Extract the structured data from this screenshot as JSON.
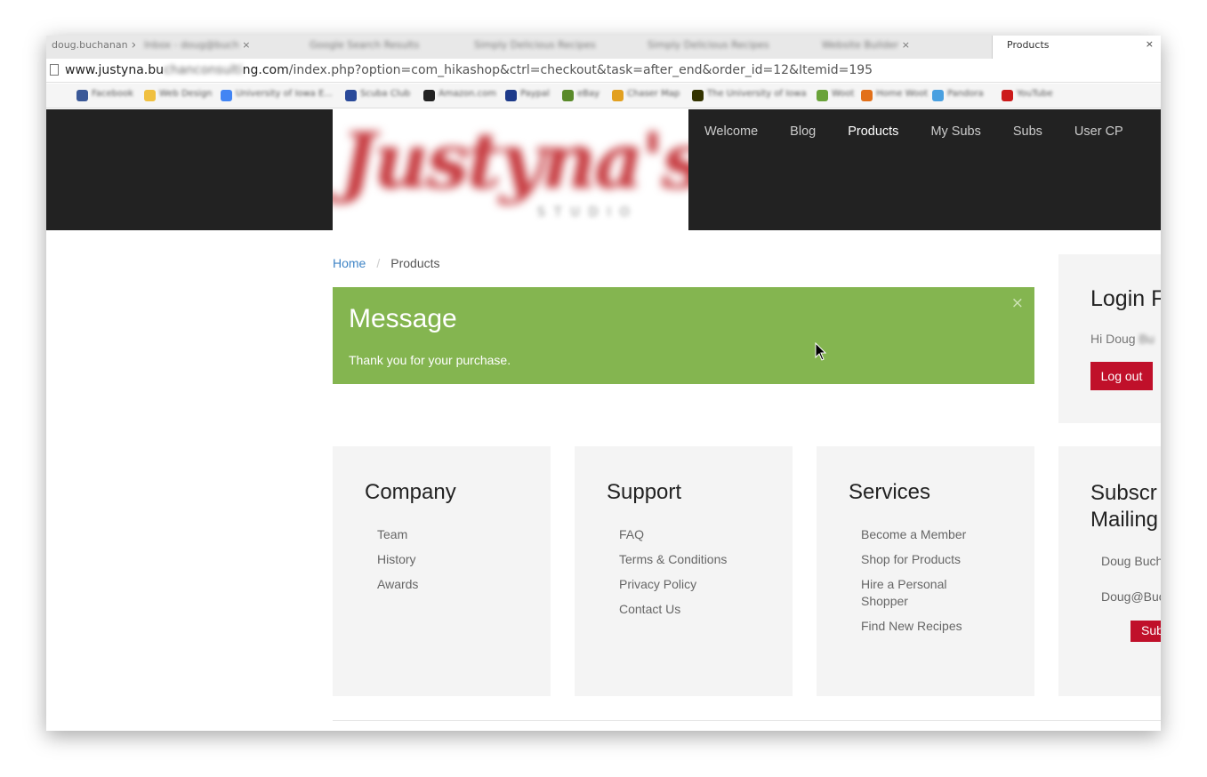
{
  "browser": {
    "tabs": [
      {
        "label": "doug.buchanan",
        "blurred": false
      },
      {
        "label": "Inbox - doug@buch",
        "blurred": true
      },
      {
        "label": "Google Search Results",
        "blurred": true
      },
      {
        "label": "Simply Delicious Recipes",
        "blurred": true
      },
      {
        "label": "Simply Delicious Recipes",
        "blurred": true
      },
      {
        "label": "Website Builder",
        "blurred": true
      }
    ],
    "active_tab": {
      "label": "Products",
      "close": "×"
    },
    "url": {
      "host_visible_start": "www.justyna.bu",
      "host_blurred": "chanconsulti",
      "host_visible_end": "ng.com",
      "path": "/index.php?option=com_hikashop&ctrl=checkout&task=after_end&order_id=12&Itemid=195"
    },
    "bookmarks": [
      {
        "label": "Facebook",
        "color": "#3b5998"
      },
      {
        "label": "Web Design",
        "color": "#f0c040"
      },
      {
        "label": "University of Iowa E...",
        "color": "#4285f4"
      },
      {
        "label": "Scuba Club",
        "color": "#2a4a9a"
      },
      {
        "label": "Amazon.com",
        "color": "#222222"
      },
      {
        "label": "Paypal",
        "color": "#1d3a8a"
      },
      {
        "label": "eBay",
        "color": "#5a8a2a"
      },
      {
        "label": "Chaser Map",
        "color": "#e2a020"
      },
      {
        "label": "The University of Iowa",
        "color": "#333300"
      },
      {
        "label": "Woot",
        "color": "#6aa33a"
      },
      {
        "label": "Home Woot",
        "color": "#e2701a"
      },
      {
        "label": "Pandora",
        "color": "#4aa0e0"
      },
      {
        "label": "YouTube",
        "color": "#cc1b1b"
      }
    ]
  },
  "site": {
    "logo_text": "Justyna's",
    "nav": [
      "Welcome",
      "Blog",
      "Products",
      "My Subs",
      "Subs",
      "User CP"
    ],
    "nav_active": "Products"
  },
  "breadcrumb": {
    "home": "Home",
    "current": "Products"
  },
  "message": {
    "title": "Message",
    "text": "Thank you for your purchase.",
    "close": "×"
  },
  "login": {
    "title": "Login F",
    "greeting": "Hi Doug",
    "greeting_blurred": "Bu",
    "logout_label": "Log out"
  },
  "footer": {
    "company": {
      "title": "Company",
      "links": [
        "Team",
        "History",
        "Awards"
      ]
    },
    "support": {
      "title": "Support",
      "links": [
        "FAQ",
        "Terms & Conditions",
        "Privacy Policy",
        "Contact Us"
      ]
    },
    "services": {
      "title": "Services",
      "links": [
        "Become a Member",
        "Shop for Products",
        "Hire a Personal Shopper",
        "Find New Recipes"
      ]
    },
    "subscribe": {
      "title_line1": "Subscr",
      "title_line2": "Mailing",
      "name_value": "Doug Buch",
      "email_value": "Doug@Buc",
      "button_label": "Sub"
    }
  },
  "colors": {
    "header_bg": "#222222",
    "message_bg": "#84b550",
    "button_red": "#c0102a",
    "link_blue": "#3f84c6"
  }
}
